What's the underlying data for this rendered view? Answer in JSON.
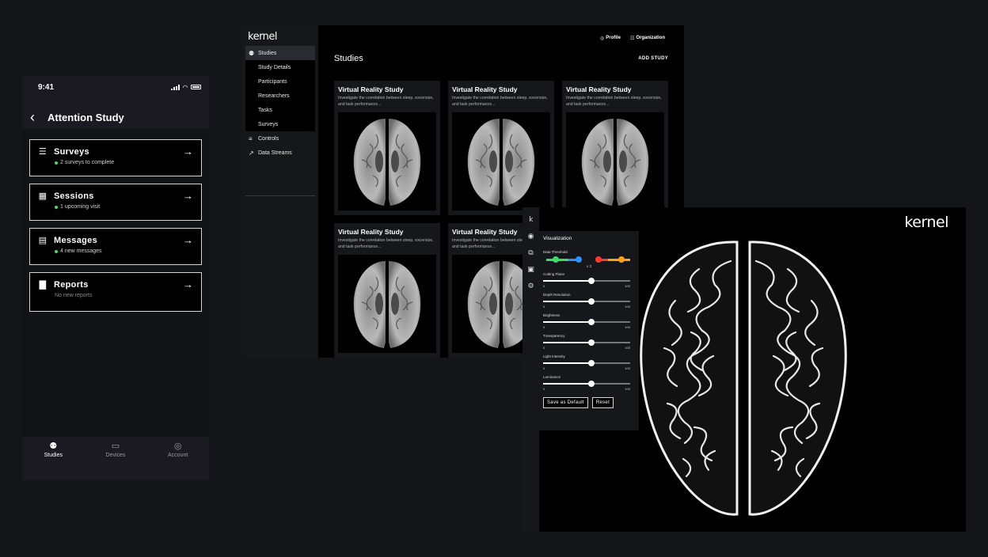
{
  "phone": {
    "time": "9:41",
    "title": "Attention Study",
    "cards": [
      {
        "title": "Surveys",
        "subtitle": "2 surveys to complete",
        "icon": "list-icon",
        "has_dot": true
      },
      {
        "title": "Sessions",
        "subtitle": "1 upcoming visit",
        "icon": "calendar-icon",
        "has_dot": true
      },
      {
        "title": "Messages",
        "subtitle": "4 new messages",
        "icon": "chat-icon",
        "has_dot": true
      },
      {
        "title": "Reports",
        "subtitle": "No new reports",
        "icon": "bar-chart-icon",
        "has_dot": false
      }
    ],
    "tabs": [
      {
        "label": "Studies",
        "icon": "lightbulb-icon",
        "active": true
      },
      {
        "label": "Devices",
        "icon": "headset-icon",
        "active": false
      },
      {
        "label": "Account",
        "icon": "person-circle-icon",
        "active": false
      }
    ],
    "colors": {
      "dot": "#4cd964",
      "background": "#1b1a23"
    }
  },
  "desktop": {
    "logo": "kernel",
    "sidebar": {
      "studies": "Studies",
      "sub_items": [
        "Study Details",
        "Participants",
        "Researchers",
        "Tasks",
        "Surveys"
      ],
      "controls": "Controls",
      "data_streams": "Data Streams"
    },
    "top": {
      "profile": "Profile",
      "organization": "Organization"
    },
    "heading": "Studies",
    "add_study": "ADD STUDY",
    "study_cards": [
      {
        "title": "Virtual Reality Study",
        "description": "Investigate the correlation between sleep, excersize, and task performance..."
      },
      {
        "title": "Virtual Reality Study",
        "description": "Investigate the correlation between sleep, excersize, and task performance..."
      },
      {
        "title": "Virtual Reality Study",
        "description": "Investigate the correlation between sleep, excersize, and task performance..."
      },
      {
        "title": "Virtual Reality Study",
        "description": "Investigate the correlation between sleep, excersize, and task performance..."
      },
      {
        "title": "Virtual Reality Study",
        "description": "Investigate the correlation between sleep, excersize, and task performance..."
      }
    ]
  },
  "viewer": {
    "logo": "kernel",
    "panel_title": "Visualization",
    "threshold_label": "Data Threshold",
    "threshold_multiplier": "x 3",
    "threshold_colors": [
      "#3ddc6a",
      "#2f8fff",
      "#ff3b30",
      "#ff9f1a"
    ],
    "sliders": [
      {
        "label": "Cutting Plane",
        "min": "0",
        "max": "100",
        "value": 55
      },
      {
        "label": "Depth Resolution",
        "min": "0",
        "max": "100",
        "value": 55
      },
      {
        "label": "Brightness",
        "min": "0",
        "max": "100",
        "value": 55
      },
      {
        "label": "Transparency",
        "min": "0",
        "max": "100",
        "value": 55
      },
      {
        "label": "Light Intensity",
        "min": "0",
        "max": "100",
        "value": 55
      },
      {
        "label": "Luminance",
        "min": "0",
        "max": "100",
        "value": 55
      }
    ],
    "save_default": "Save as Default",
    "reset": "Reset"
  }
}
